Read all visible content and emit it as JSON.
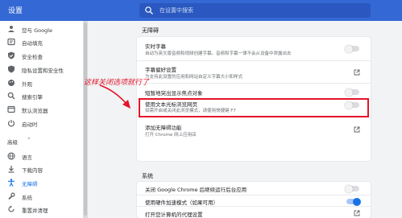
{
  "header": {
    "title": "设置",
    "search_placeholder": "在设置中搜索"
  },
  "sidebar": {
    "items": [
      {
        "label": "您与 Google",
        "icon": "person-icon"
      },
      {
        "label": "自动填充",
        "icon": "autofill-icon"
      },
      {
        "label": "安全检查",
        "icon": "shield-check-icon"
      },
      {
        "label": "隐私设置和安全性",
        "icon": "shield-icon"
      },
      {
        "label": "外观",
        "icon": "palette-icon"
      },
      {
        "label": "搜索引擎",
        "icon": "search-icon"
      },
      {
        "label": "默认浏览器",
        "icon": "browser-icon"
      },
      {
        "label": "启动时",
        "icon": "power-icon"
      }
    ],
    "advanced_label": "高级",
    "advanced_items": [
      {
        "label": "语言",
        "icon": "globe-icon"
      },
      {
        "label": "下载内容",
        "icon": "download-icon"
      },
      {
        "label": "无障碍",
        "icon": "accessibility-icon",
        "active": true
      },
      {
        "label": "系统",
        "icon": "wrench-icon"
      },
      {
        "label": "重置并清理",
        "icon": "reset-icon"
      }
    ]
  },
  "accessibility": {
    "section_title": "无障碍",
    "rows": [
      {
        "title": "实时字幕",
        "desc": "自动为英文版音频和视频创建字幕。音频和字幕一律不会从设备中泄露出去",
        "control": "toggle",
        "on": false
      },
      {
        "title": "字幕偏好设置",
        "desc": "为支持此设置的应用和网站自定义字幕大小和样式",
        "control": "external"
      },
      {
        "title": "短暂地突出显示焦点对象",
        "desc": "",
        "control": "toggle",
        "on": false
      },
      {
        "title": "使用文本光标浏览网页",
        "desc": "如需开启或关闭此浏览模式，请使用快捷键 F7",
        "control": "toggle",
        "on": false,
        "highlighted": true
      },
      {
        "title": "添加无障碍功能",
        "desc": "打开 Chrome 网上应用店",
        "control": "external"
      }
    ]
  },
  "system": {
    "section_title": "系统",
    "rows": [
      {
        "title": "关闭 Google Chrome 后继续运行后台应用",
        "control": "toggle",
        "on": false
      },
      {
        "title": "使用硬件加速模式（如果可用）",
        "control": "toggle",
        "on": true
      },
      {
        "title": "打开您计算机的代理设置",
        "control": "external"
      }
    ]
  },
  "annotation": {
    "text": "这样关闭选项就行了",
    "color": "#e3142b"
  },
  "colors": {
    "header": "#3468d4",
    "accent": "#1a73e8",
    "annotation": "#e3142b"
  }
}
